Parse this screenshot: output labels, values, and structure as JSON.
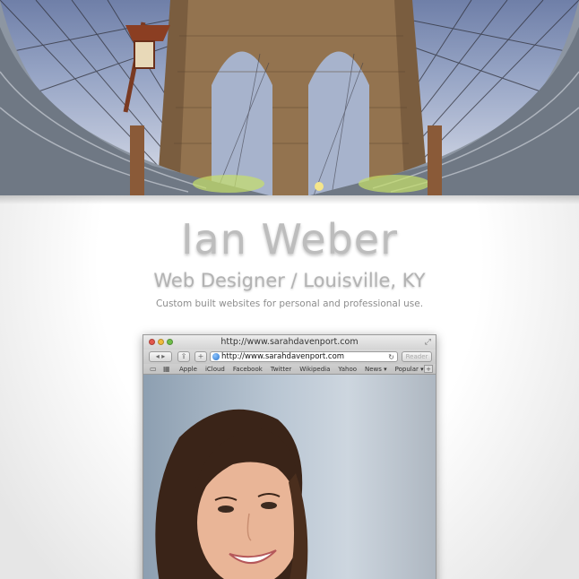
{
  "header": {
    "name": "Ian Weber",
    "role": "Web Designer / Louisville, KY",
    "tagline": "Custom built websites for personal and professional use."
  },
  "browser": {
    "window_title": "http://www.sarahdavenport.com",
    "url": "http://www.sarahdavenport.com",
    "reader_label": "Reader",
    "bookmarks": [
      "Apple",
      "iCloud",
      "Facebook",
      "Twitter",
      "Wikipedia",
      "Yahoo",
      "News ▾",
      "Popular ▾"
    ]
  },
  "colors": {
    "name_text": "#bdbdbd",
    "role_text": "#b3b3b3",
    "tagline_text": "#8d8d8d",
    "traffic_red": "#e2574c",
    "traffic_yellow": "#f0bb3b",
    "traffic_green": "#6fbf4a"
  },
  "icons": [
    "back-forward-icon",
    "share-icon",
    "add-icon",
    "globe-icon",
    "reload-icon",
    "book-icon",
    "grid-icon",
    "resize-icon",
    "plus-icon"
  ]
}
